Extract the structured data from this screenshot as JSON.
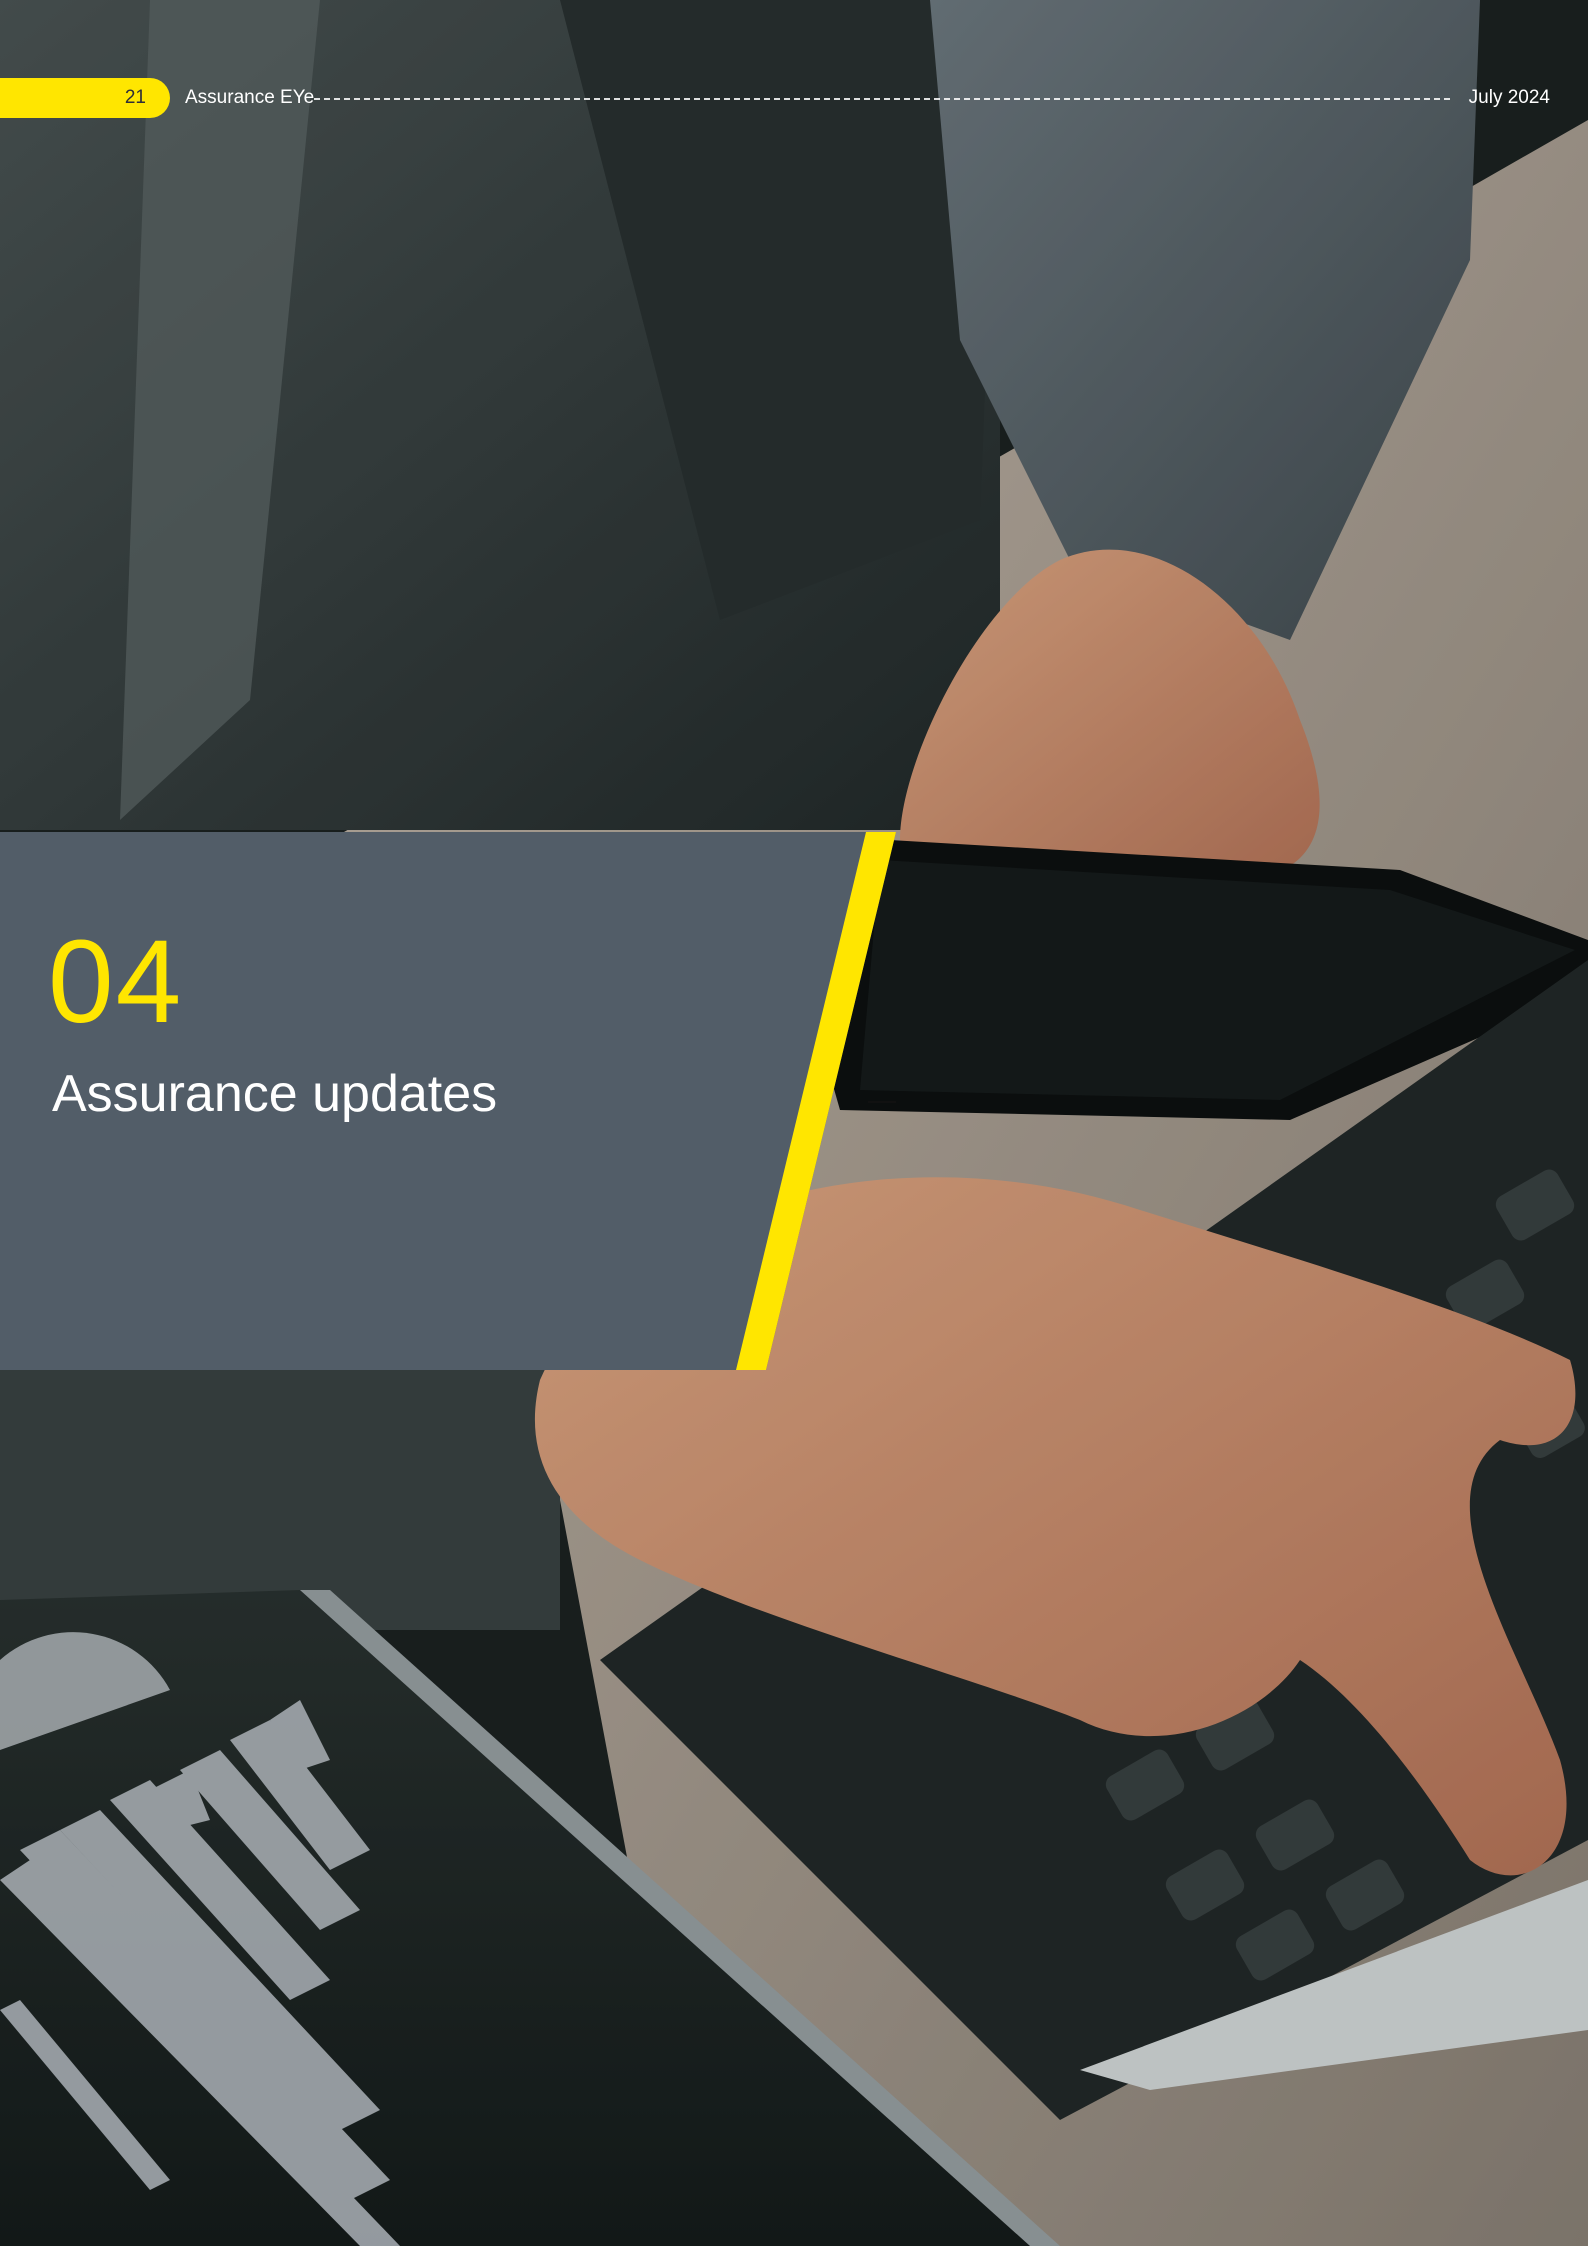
{
  "header": {
    "page_number": "21",
    "publication": "Assurance EYe",
    "date": "July 2024"
  },
  "section": {
    "number": "04",
    "title": "Assurance updates"
  },
  "colors": {
    "accent_yellow": "#ffe600",
    "panel_gray": "#525d68",
    "text_white": "#ffffff"
  }
}
